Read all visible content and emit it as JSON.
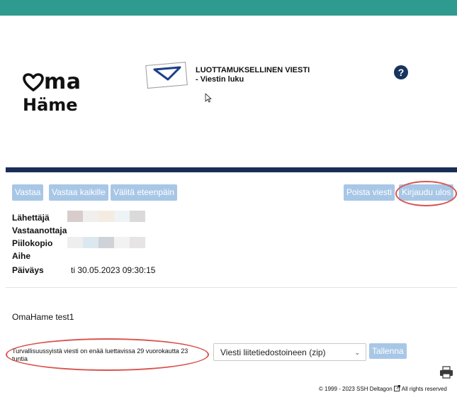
{
  "logo": {
    "line1": "ma",
    "line2": "Häme"
  },
  "header": {
    "title_line1": "LUOTTAMUKSELLINEN VIESTI",
    "title_line2": "- Viestin luku",
    "help_symbol": "?"
  },
  "toolbar": {
    "reply": "Vastaa",
    "reply_all": "Vastaa kaikille",
    "forward": "Välitä eteenpäin",
    "delete": "Poista viesti",
    "logout": "Kirjaudu ulos"
  },
  "fields": {
    "sender_label": "Lähettäjä",
    "recipient_label": "Vastaanottaja",
    "bcc_label": "Piilokopio",
    "subject_label": "Aihe",
    "date_label": "Päiväys",
    "date_value": "ti 30.05.2023 09:30:15"
  },
  "message": {
    "body": "OmaHame test1",
    "notice": "Turvallisuussyistä viesti on enää luettavissa 29 vuorokautta 23 tuntia"
  },
  "download": {
    "select_value": "Viesti liitetiedostoineen (zip)",
    "save_button": "Tallenna"
  },
  "footer": {
    "copyright": "© 1999 - 2023 SSH Deltagon",
    "rights": "All rights reserved"
  },
  "colors": {
    "top_bar": "#2f9a8f",
    "navy_bar": "#1a2d57",
    "button": "#a8c7e6",
    "highlight": "#d9534f"
  },
  "icons": [
    "envelope-icon",
    "help-icon",
    "mouse-cursor-icon",
    "chevron-down-icon",
    "external-link-icon",
    "printer-icon"
  ]
}
